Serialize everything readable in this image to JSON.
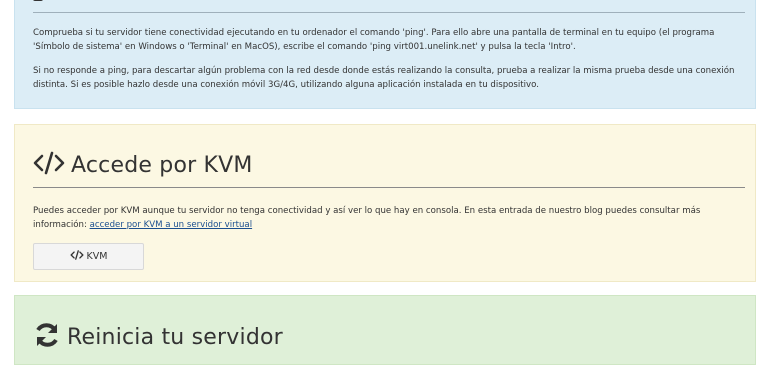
{
  "ping_panel": {
    "paragraph1": "Comprueba si tu servidor tiene conectividad ejecutando en tu ordenador el comando 'ping'. Para ello abre una pantalla de terminal en tu equipo (el programa 'Símbolo de sistema' en Windows o 'Terminal' en MacOS), escribe el comando 'ping virt001.unelink.net' y pulsa la tecla 'Intro'.",
    "paragraph2": "Si no responde a ping, para descartar algún problema con la red desde donde estás realizando la consulta, prueba a realizar la misma prueba desde una conexión distinta. Si es posible hazlo desde una conexión móvil 3G/4G, utilizando alguna aplicación instalada en tu dispositivo."
  },
  "kvm_panel": {
    "title": "Accede por KVM",
    "icon": "code-icon",
    "text": "Puedes acceder por KVM aunque tu servidor no tenga conectividad y así ver lo que hay en consola. En esta entrada de nuestro blog puedes consultar más información:",
    "link": "acceder por KVM a un servidor virtual",
    "button_label": "KVM"
  },
  "reboot_panel": {
    "title": "Reinicia tu servidor",
    "icon": "refresh-icon"
  },
  "colors": {
    "info_bg": "#dcedf6",
    "warning_bg": "#fcf8e3",
    "success_bg": "#dff0d8",
    "link": "#1b4f8f"
  }
}
